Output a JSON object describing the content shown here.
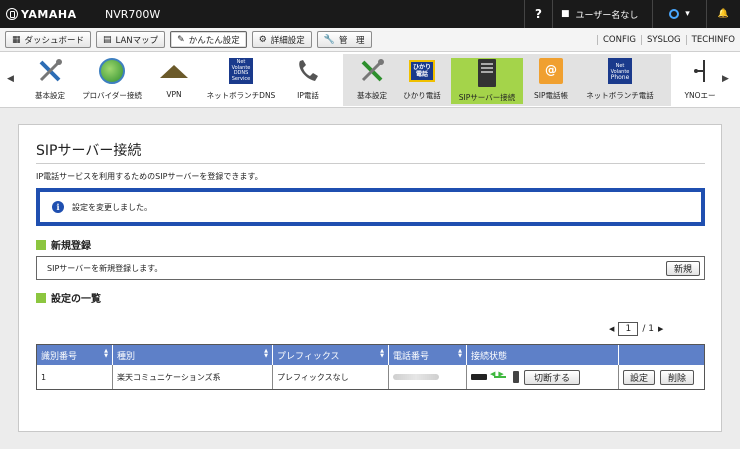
{
  "brand": "YAMAHA",
  "model": "NVR700W",
  "topbar": {
    "help": "?",
    "user": "ユーザー名なし"
  },
  "nav": {
    "buttons": [
      {
        "icon": "dashboard-icon",
        "label": "ダッシュボード"
      },
      {
        "icon": "lan-map-icon",
        "label": "LANマップ"
      },
      {
        "icon": "easy-setup-icon",
        "label": "かんたん設定"
      },
      {
        "icon": "gear-icon",
        "label": "詳細設定"
      },
      {
        "icon": "wrench-icon",
        "label": "管　理"
      }
    ],
    "active": "かんたん設定",
    "links": [
      "CONFIG",
      "SYSLOG",
      "TECHINFO"
    ]
  },
  "toolbar": {
    "items": [
      {
        "label": "基本設定"
      },
      {
        "label": "プロバイダー接続"
      },
      {
        "label": "VPN"
      },
      {
        "label": "ネットボランチDNS",
        "icon_text": [
          "Net",
          "Volante",
          "DDNS",
          "Service"
        ]
      },
      {
        "label": "IP電話"
      },
      {
        "label": "基本設定"
      },
      {
        "label": "ひかり電話",
        "icon_text": [
          "ひかり",
          "電話"
        ]
      },
      {
        "label": "SIPサーバー接続",
        "selected": true
      },
      {
        "label": "SIP電話帳"
      },
      {
        "label": "ネットボランチ電話",
        "icon_text": [
          "Net",
          "Volante",
          "Phone"
        ]
      },
      {
        "label": "YNOエー"
      }
    ],
    "selected_color": "#a4d44a"
  },
  "page": {
    "title": "SIPサーバー接続",
    "description": "IP電話サービスを利用するためのSIPサーバーを登録できます。",
    "message": "設定を変更しました。",
    "new_section_title": "新規登録",
    "new_section_text": "SIPサーバーを新規登録します。",
    "new_button": "新規",
    "list_section_title": "設定の一覧",
    "pager": {
      "current": "1",
      "total": "/ 1"
    },
    "table": {
      "headers": [
        "識別番号",
        "種別",
        "プレフィックス",
        "電話番号",
        "接続状態"
      ],
      "rows": [
        {
          "id": "1",
          "type": "楽天コミュニケーションズ系",
          "prefix": "プレフィックスなし",
          "disconnect": "切断する",
          "edit": "設定",
          "delete": "削除"
        }
      ]
    }
  },
  "colors": {
    "accent_blue": "#1f4fb0",
    "table_header": "#5e80c8",
    "section_green": "#8cc63f"
  }
}
